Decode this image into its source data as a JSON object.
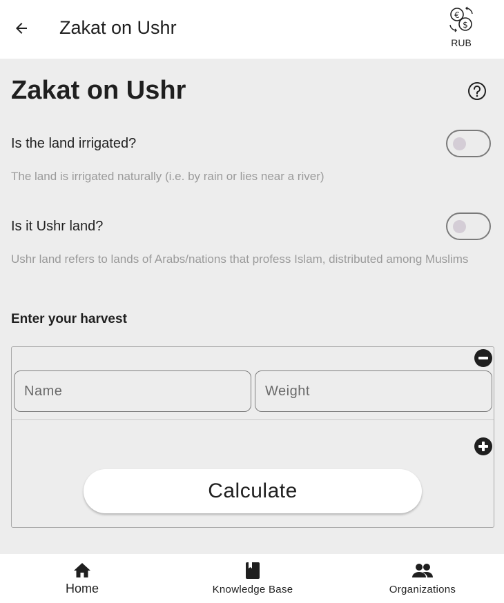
{
  "appbar": {
    "title": "Zakat on Ushr",
    "back_icon": "arrow-left-icon",
    "currency_icon": "currency-exchange-icon",
    "currency_code": "RUB"
  },
  "page": {
    "title": "Zakat on Ushr",
    "help_icon": "help-circle-icon"
  },
  "questions": [
    {
      "label": "Is the land irrigated?",
      "hint": "The land is irrigated naturally (i.e. by rain or lies near a river)",
      "enabled": false
    },
    {
      "label": "Is it Ushr land?",
      "hint": "Ushr land refers to lands of Arabs/nations that profess Islam, distributed among Muslims",
      "enabled": false
    }
  ],
  "harvest": {
    "section_label": "Enter your harvest",
    "name_placeholder": "Name",
    "weight_placeholder": "Weight",
    "remove_icon": "minus-circle-icon",
    "add_icon": "plus-circle-icon",
    "calculate_label": "Calculate"
  },
  "bottom_nav": [
    {
      "label": "Home",
      "icon": "home-icon"
    },
    {
      "label": "Knowledge Base",
      "icon": "book-icon"
    },
    {
      "label": "Organizations",
      "icon": "people-icon"
    }
  ],
  "colors": {
    "background": "#ededed",
    "surface": "#ffffff",
    "text": "#1f1f1f",
    "hint": "#9a9a9a"
  }
}
